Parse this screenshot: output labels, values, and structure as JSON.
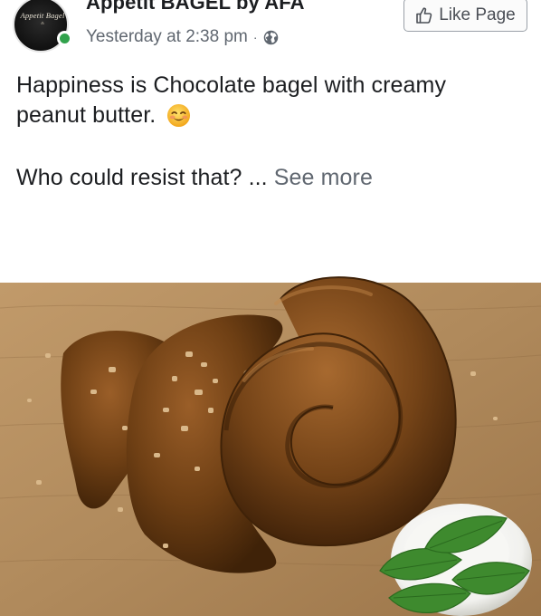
{
  "post": {
    "page_name": "Appetit BAGEL by AFA",
    "avatar": {
      "logo_text": "Appetit Bagel",
      "colors": {
        "background": "#111111",
        "online_dot": "#31a24c"
      }
    },
    "timestamp": "Yesterday at 2:38 pm",
    "separator": "·",
    "audience_icon": "globe-icon",
    "like_page_button": {
      "label": "Like Page",
      "icon": "thumbs-up-icon"
    },
    "text": {
      "line1": "Happiness is Chocolate bagel with creamy",
      "line2": "peanut butter.",
      "emoji": "smiling-face-emoji",
      "line3_prefix": "Who could resist that? ...",
      "see_more": "See more"
    },
    "photo": {
      "subject": "chocolate-bagel-with-peanut-butter-photo",
      "colors": {
        "board": "#b08a5c",
        "spread": "#6e3f14",
        "nuts": "#d9b88a",
        "mint": "#3e8a2e",
        "bowl": "#f1f1ee"
      }
    }
  }
}
